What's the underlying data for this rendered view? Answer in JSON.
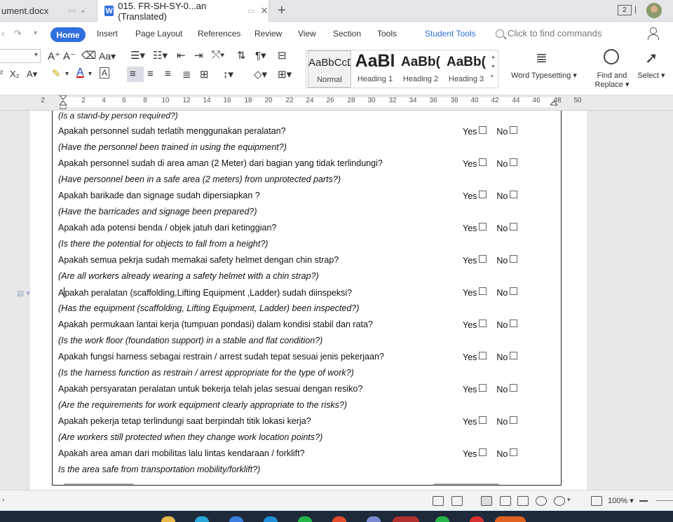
{
  "tabs": {
    "inactive": "ument.docx",
    "active": "015. FR-SH-SY-0...an (Translated)",
    "window_count": "2"
  },
  "menu": {
    "home": "Home",
    "insert": "Insert",
    "page_layout": "Page Layout",
    "references": "References",
    "review": "Review",
    "view": "View",
    "section": "Section",
    "tools": "Tools",
    "student_tools": "Student Tools",
    "find_commands": "Click to find commands"
  },
  "ribbon": {
    "styles": [
      {
        "preview": "AaBbCcD",
        "label": "Normal"
      },
      {
        "preview": "AaBl",
        "label": "Heading 1"
      },
      {
        "preview": "AaBb(",
        "label": "Heading 2"
      },
      {
        "preview": "AaBb(",
        "label": "Heading 3"
      }
    ],
    "word_typesetting": "Word Typesetting",
    "find_replace_1": "Find and",
    "find_replace_2": "Replace",
    "select": "Select"
  },
  "ruler": [
    "2",
    "2",
    "4",
    "6",
    "8",
    "10",
    "12",
    "14",
    "16",
    "18",
    "20",
    "22",
    "24",
    "26",
    "28",
    "30",
    "32",
    "34",
    "36",
    "38",
    "40",
    "42",
    "44",
    "46",
    "48",
    "50"
  ],
  "document": {
    "top_partial": "(Is a stand-by person required?)",
    "yes_label": "Yes",
    "no_label": "No",
    "questions": [
      {
        "id": "Apakah personnel sudah terlatih menggunakan peralatan?",
        "en": "(Have the personnel been trained in using the equipment?)"
      },
      {
        "id": "Apakah personnel sudah di area aman (2 Meter) dari bagian yang tidak terlindungi?",
        "en": "(Have personnel been in a safe area (2 meters) from unprotected parts?)"
      },
      {
        "id": "Apakah barikade dan signage sudah dipersiapkan ?",
        "en": "(Have the barricades and signage been prepared?)"
      },
      {
        "id": "Apakah ada potensi benda / objek jatuh dari ketinggian?",
        "en": "(Is there the potential for objects to fall from a height?)"
      },
      {
        "id": "Apakah semua pekrja sudah memakai safety helmet dengan chin strap?",
        "en": "(Are all workers already wearing a safety helmet with a chin strap?)"
      },
      {
        "id": "pakah peralatan (scaffolding,Lifting Equipment ,Ladder) sudah diinspeksi?",
        "en": "(Has the equipment (scaffolding, Lifting Equipment, Ladder) been inspected?)"
      },
      {
        "id": "Apakah permukaan lantai kerja (tumpuan pondasi) dalam kondisi stabil dan rata?",
        "en": "(Is the work floor  (foundation support) in a stable and flat condition?)"
      },
      {
        "id": "Apakah fungsi harness sebagai restrain / arrest sudah tepat sesuai jenis pekerjaan?",
        "en": "(Is the harness function as restrain / arrest appropriate for the type of work?)"
      },
      {
        "id": "Apakah persyaratan peralatan untuk bekerja telah jelas sesuai dengan resiko?",
        "en": "(Are the requirements for work equipment clearly appropriate to the risks?)"
      },
      {
        "id": "Apakah pekerja tetap terlindungi saat berpindah titik lokasi kerja?",
        "en": "(Are workers still protected when they change work location points?)"
      },
      {
        "id": "Apakah area aman dari mobilitas lalu lintas kendaraan / forklift?",
        "en": "Is the area safe from transportation mobility/forklift?)"
      }
    ],
    "cursor_letter": "A"
  },
  "status": {
    "zoom": "100%"
  }
}
